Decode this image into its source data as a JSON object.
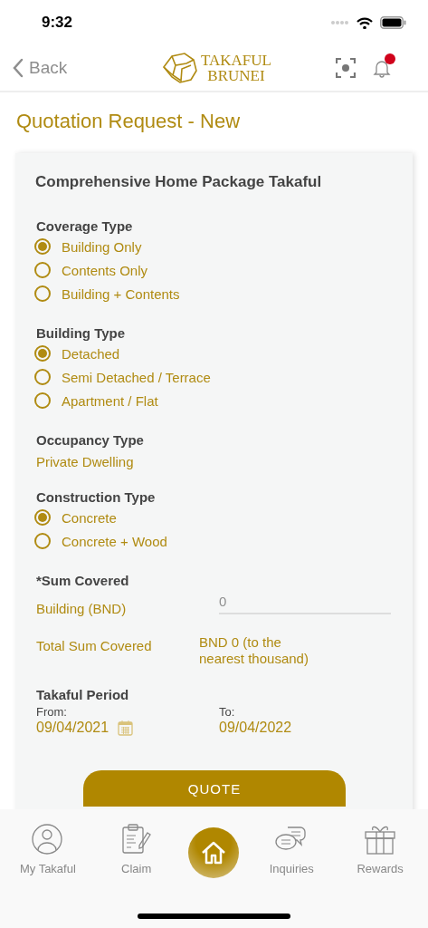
{
  "status_bar": {
    "time": "9:32"
  },
  "nav_bar": {
    "back": "Back",
    "logo_line1": "TAKAFUL",
    "logo_line2": "BRUNEI",
    "notification_badge": true
  },
  "page_title": "Quotation Request - New",
  "form": {
    "title": "Comprehensive Home Package Takaful",
    "sections": [
      {
        "kind": "radio",
        "label": "Coverage Type",
        "options": [
          {
            "label": "Building Only",
            "selected": true
          },
          {
            "label": "Contents Only",
            "selected": false
          },
          {
            "label": "Building + Contents",
            "selected": false
          }
        ]
      },
      {
        "kind": "radio",
        "label": "Building Type",
        "options": [
          {
            "label": "Detached",
            "selected": true
          },
          {
            "label": "Semi Detached / Terrace",
            "selected": false
          },
          {
            "label": "Apartment / Flat",
            "selected": false
          }
        ]
      },
      {
        "kind": "text",
        "label": "Occupancy Type",
        "value": "Private Dwelling"
      },
      {
        "kind": "radio",
        "label": "Construction Type",
        "options": [
          {
            "label": "Concrete",
            "selected": true
          },
          {
            "label": "Concrete + Wood",
            "selected": false
          }
        ]
      },
      {
        "kind": "sum",
        "label": "*Sum Covered",
        "rows": [
          {
            "kind": "input",
            "label": "Building (BND)",
            "placeholder": "0"
          },
          {
            "kind": "text",
            "label": "Total Sum Covered",
            "value": "BND 0 (to the nearest thousand)"
          }
        ]
      },
      {
        "kind": "period",
        "label": "Takaful Period",
        "from_label": "From:",
        "from_value": "09/04/2021",
        "to_label": "To:",
        "to_value": "09/04/2022"
      }
    ],
    "submit": "QUOTE"
  },
  "tab_bar": [
    {
      "kind": "person",
      "label": "My Takaful"
    },
    {
      "kind": "clipboard",
      "label": "Claim"
    },
    {
      "kind": "home"
    },
    {
      "kind": "chat",
      "label": "Inquiries"
    },
    {
      "kind": "gift",
      "label": "Rewards"
    }
  ]
}
